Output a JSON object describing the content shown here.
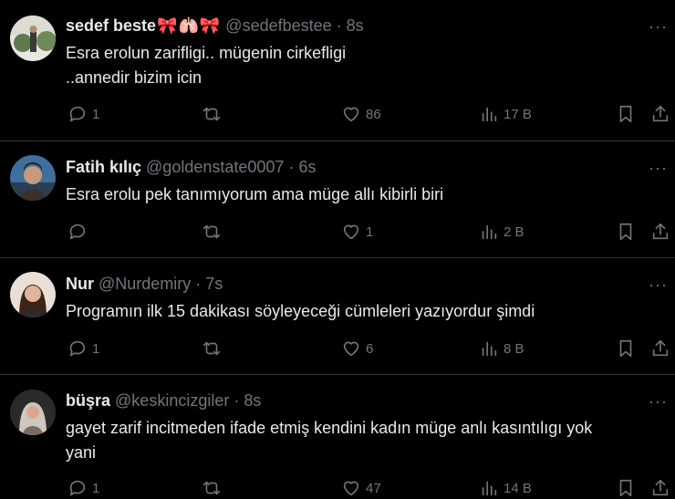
{
  "tweets": [
    {
      "name": "sedef beste",
      "emoji": "🎀🫁🎀",
      "handle": "@sedefbestee",
      "separator": "·",
      "time": "8s",
      "text_lines": [
        "Esra erolun zarifligi.. mügenin cirkefligi",
        "..annedir bizim icin"
      ],
      "replies": "1",
      "retweets": "",
      "likes": "86",
      "views": "17 B",
      "avatar_color": "#6b7a5a"
    },
    {
      "name": "Fatih kılıç",
      "emoji": "",
      "handle": "@goldenstate0007",
      "separator": "·",
      "time": "6s",
      "text_lines": [
        "Esra erolu pek tanımıyorum ama müge allı kibirli biri"
      ],
      "replies": "",
      "retweets": "",
      "likes": "1",
      "views": "2 B",
      "avatar_color": "#4a6a8a"
    },
    {
      "name": "Nur",
      "emoji": "",
      "handle": "@Nurdemiry",
      "separator": "·",
      "time": "7s",
      "text_lines": [
        "Programın ilk 15 dakikası söyleyeceği cümleleri yazıyordur şimdi"
      ],
      "replies": "1",
      "retweets": "",
      "likes": "6",
      "views": "8 B",
      "avatar_color": "#c9a58c"
    },
    {
      "name": "büşra",
      "emoji": "",
      "handle": "@keskincizgiler",
      "separator": "·",
      "time": "8s",
      "text_lines": [
        "gayet zarif incitmeden ifade etmiş kendini kadın müge anlı kasıntılıgı yok",
        "yani"
      ],
      "replies": "1",
      "retweets": "",
      "likes": "47",
      "views": "14 B",
      "avatar_color": "#8b7c70"
    }
  ],
  "more_label": "···",
  "colors": {
    "background": "#000000",
    "text": "#e7e9ea",
    "muted": "#71767b",
    "divider": "#2f3336"
  }
}
